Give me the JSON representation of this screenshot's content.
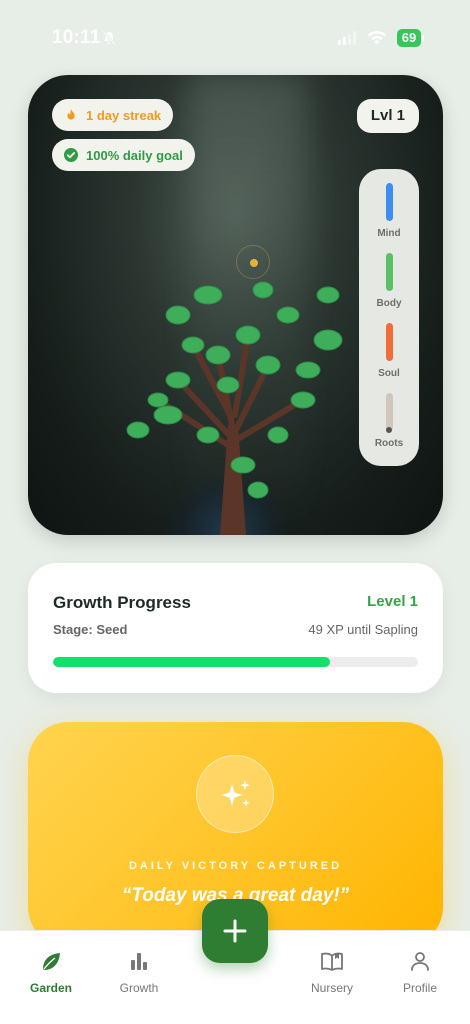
{
  "status_bar": {
    "time": "10:11",
    "battery": "69",
    "icons": [
      "bell-off-icon",
      "signal-icon",
      "wifi-icon",
      "battery-icon"
    ]
  },
  "garden": {
    "streak_label": "1 day streak",
    "goal_label": "100% daily goal",
    "level_badge": "Lvl 1",
    "stats": [
      {
        "label": "Mind",
        "color": "#3d8ef0"
      },
      {
        "label": "Body",
        "color": "#5cbf63"
      },
      {
        "label": "Soul",
        "color": "#f26b3a"
      },
      {
        "label": "Roots",
        "color": "#cfc7bd"
      }
    ],
    "colors": {
      "leaf": "#3fae5a",
      "trunk": "#5a3528",
      "sun": "#e5b23a"
    }
  },
  "progress": {
    "title": "Growth Progress",
    "level": "Level 1",
    "stage": "Stage: Seed",
    "xp_text": "49 XP until Sapling",
    "fill_fraction": 0.76,
    "fill_color": "#12e06a"
  },
  "victory": {
    "icon": "sparkles-icon",
    "label": "DAILY VICTORY CAPTURED",
    "quote": "“Today was a great day!”"
  },
  "tab_bar": {
    "tabs": [
      {
        "label": "Garden",
        "icon": "leaf-icon",
        "active": true
      },
      {
        "label": "Growth",
        "icon": "bar-chart-icon",
        "active": false
      },
      {
        "label": "Nursery",
        "icon": "book-icon",
        "active": false
      },
      {
        "label": "Profile",
        "icon": "person-icon",
        "active": false
      }
    ],
    "fab_icon": "plus-icon",
    "accent": "#2e7d32"
  }
}
